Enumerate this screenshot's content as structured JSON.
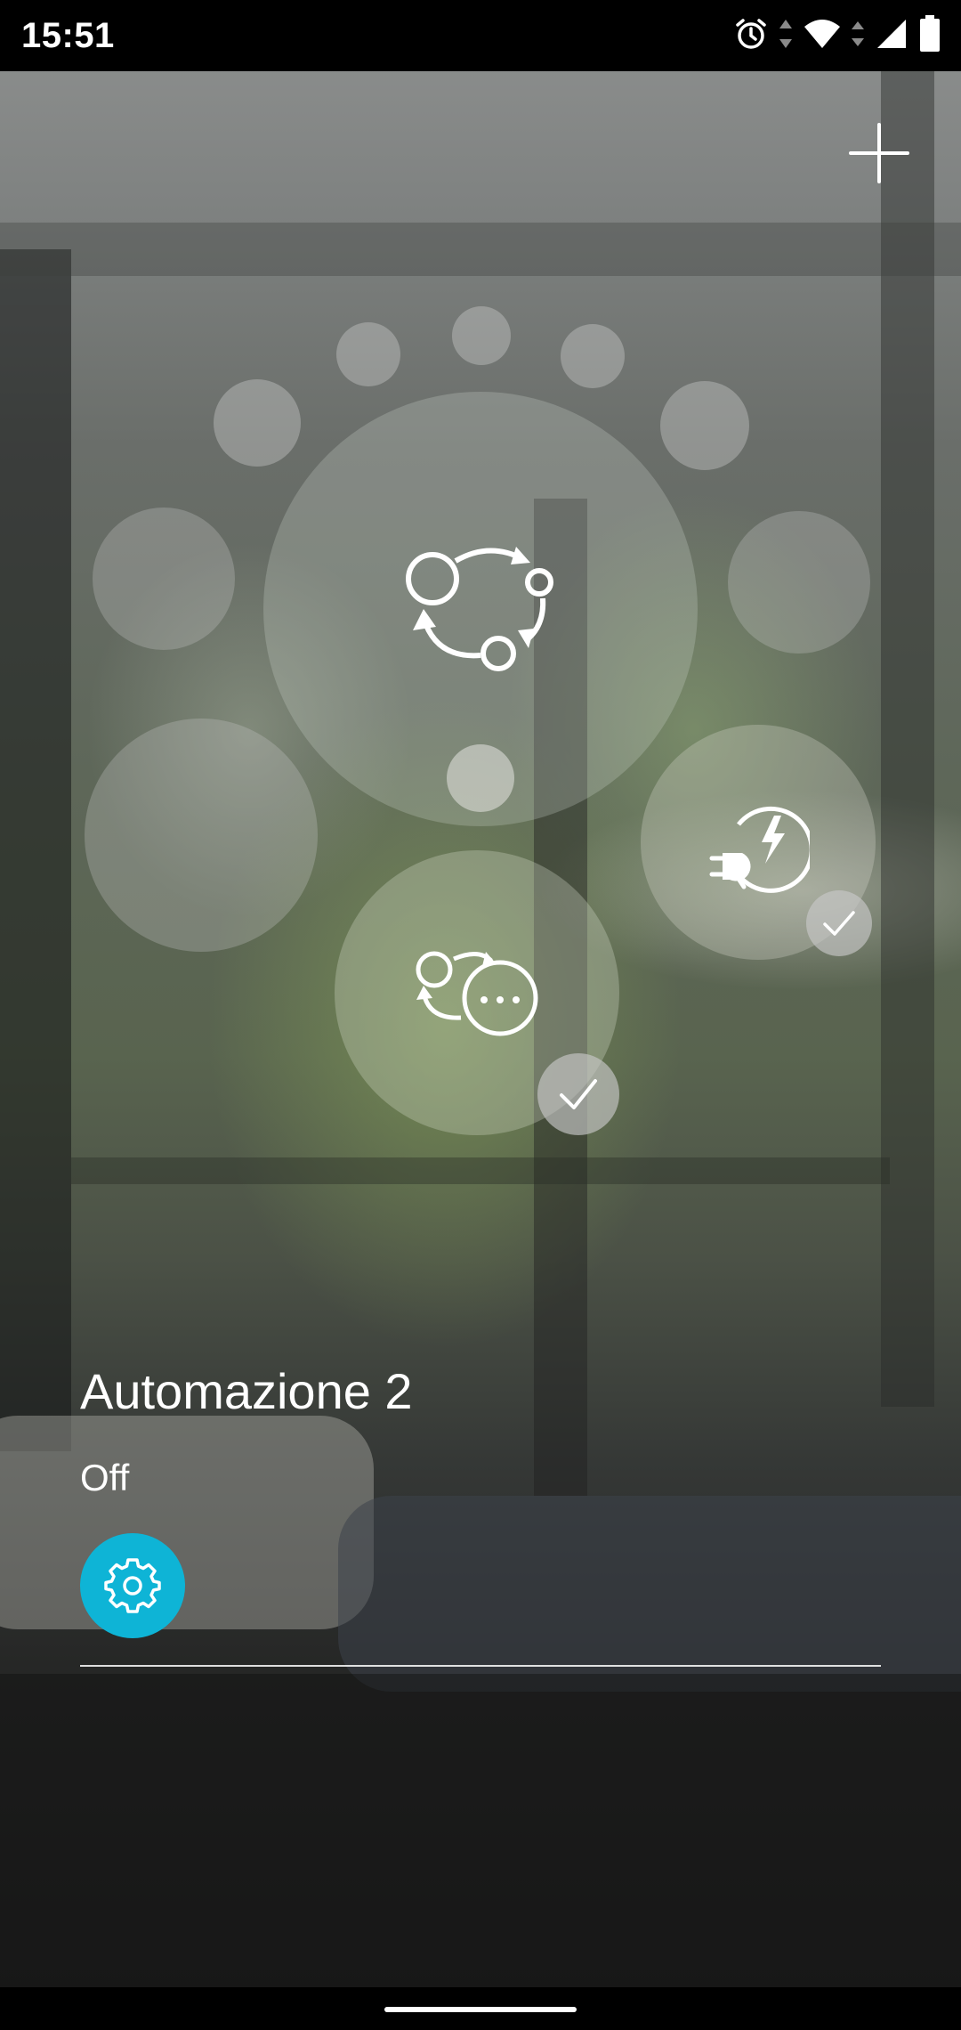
{
  "status_bar": {
    "time": "15:51",
    "icons": [
      "alarm-icon",
      "data-arrows-icon",
      "wifi-icon",
      "signal-icon",
      "battery-icon"
    ]
  },
  "toolbar": {
    "add_icon": "plus-icon"
  },
  "bubbles": {
    "main_icon": "automation-cycle-icon",
    "scene_icon": "automation-more-icon",
    "energy_icon": "energy-plug-icon",
    "check_icon": "check-icon"
  },
  "automation": {
    "name": "Automazione 2",
    "state": "Off",
    "settings_icon": "gear-icon"
  },
  "colors": {
    "accent": "#0eb4d6",
    "text": "#ffffff"
  }
}
